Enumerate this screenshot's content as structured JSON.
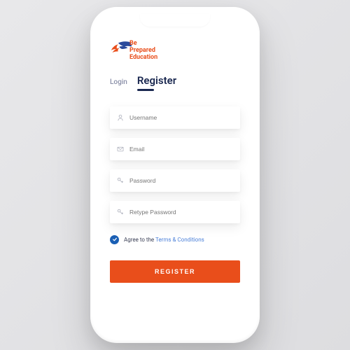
{
  "brand": {
    "line1": "Be",
    "line2": "Prepared",
    "line3": "Education",
    "colors": {
      "orange": "#e94e1b",
      "navy": "#1a2850",
      "blue": "#1a5fb4"
    }
  },
  "tabs": {
    "login": "Login",
    "register": "Register",
    "active": "register"
  },
  "fields": {
    "username": {
      "placeholder": "Username",
      "icon": "user-icon"
    },
    "email": {
      "placeholder": "Email",
      "icon": "mail-icon"
    },
    "password": {
      "placeholder": "Password",
      "icon": "key-icon"
    },
    "retype": {
      "placeholder": "Retype Password",
      "icon": "key-icon"
    }
  },
  "agree": {
    "checked": true,
    "prefix": "Agree to the ",
    "link": "Terms & Conditions"
  },
  "cta": {
    "register": "REGISTER"
  }
}
